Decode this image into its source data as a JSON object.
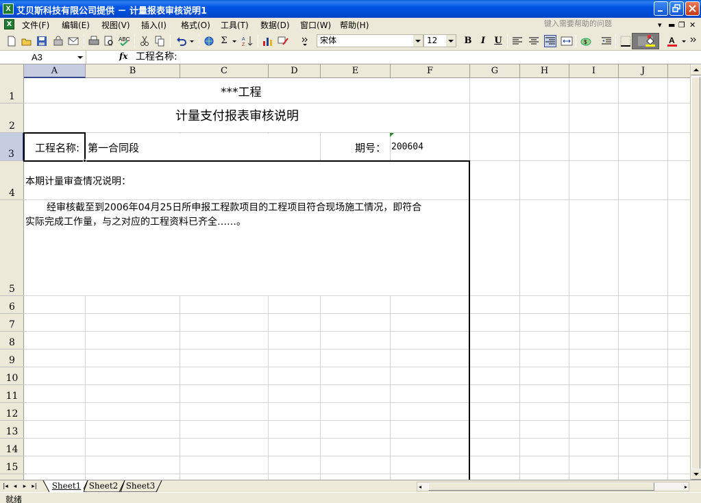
{
  "window": {
    "title": "艾贝斯科技有限公司提供 － 计量报表审核说明1",
    "app_icon": "excel-icon"
  },
  "menu": {
    "items": [
      "文件(F)",
      "编辑(E)",
      "视图(V)",
      "插入(I)",
      "格式(O)",
      "工具(T)",
      "数据(D)",
      "窗口(W)",
      "帮助(H)"
    ],
    "help_placeholder": "键入需要帮助的问题"
  },
  "toolbar": {
    "font_name": "宋体",
    "font_size": "12",
    "bold_label": "B",
    "italic_label": "I",
    "underline_label": "U",
    "sum_label": "Σ"
  },
  "formula_bar": {
    "cell_ref": "A3",
    "fx_label": "fx",
    "value": "工程名称:"
  },
  "sheet": {
    "columns": [
      "A",
      "B",
      "C",
      "D",
      "E",
      "F",
      "G",
      "H",
      "I",
      "J"
    ],
    "selected_column": "A",
    "rows": [
      "1",
      "2",
      "3",
      "4",
      "5",
      "6",
      "7",
      "8",
      "9",
      "10",
      "11",
      "12",
      "13",
      "14",
      "15"
    ],
    "selected_row": "3",
    "cells": {
      "project_title": "***工程",
      "report_title": "计量支付报表审核说明",
      "project_name_label": "工程名称:",
      "project_name_value": "第一合同段",
      "period_label": "期号：",
      "period_value": "200604",
      "section_heading": "本期计量审查情况说明：",
      "body_line1": "经审核截至到2006年04月25日所申报工程款项目的工程项目符合现场施工情况，即符合",
      "body_line2": "实际完成工作量，与之对应的工程资料已齐全……。"
    }
  },
  "tabs": {
    "sheets": [
      "Sheet1",
      "Sheet2",
      "Sheet3"
    ],
    "active": "Sheet1"
  },
  "status": {
    "text": "就绪"
  }
}
